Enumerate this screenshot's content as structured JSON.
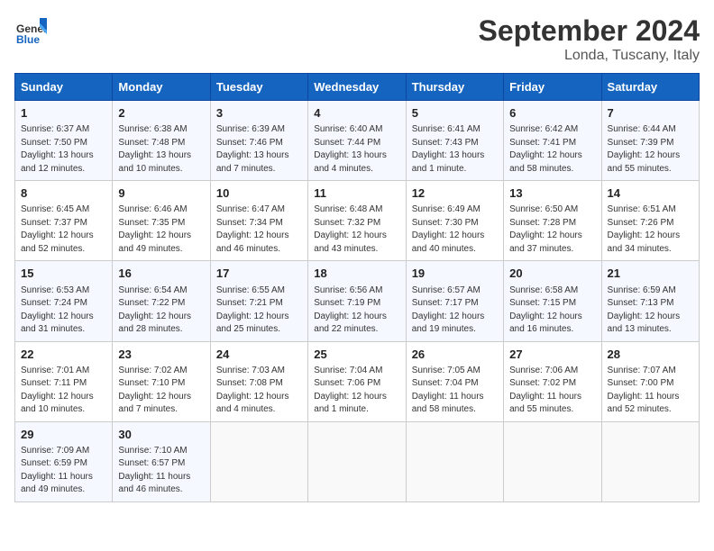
{
  "header": {
    "logo_line1": "General",
    "logo_line2": "Blue",
    "title": "September 2024",
    "location": "Londa, Tuscany, Italy"
  },
  "columns": [
    "Sunday",
    "Monday",
    "Tuesday",
    "Wednesday",
    "Thursday",
    "Friday",
    "Saturday"
  ],
  "weeks": [
    [
      {
        "day": "1",
        "lines": [
          "Sunrise: 6:37 AM",
          "Sunset: 7:50 PM",
          "Daylight: 13 hours",
          "and 12 minutes."
        ]
      },
      {
        "day": "2",
        "lines": [
          "Sunrise: 6:38 AM",
          "Sunset: 7:48 PM",
          "Daylight: 13 hours",
          "and 10 minutes."
        ]
      },
      {
        "day": "3",
        "lines": [
          "Sunrise: 6:39 AM",
          "Sunset: 7:46 PM",
          "Daylight: 13 hours",
          "and 7 minutes."
        ]
      },
      {
        "day": "4",
        "lines": [
          "Sunrise: 6:40 AM",
          "Sunset: 7:44 PM",
          "Daylight: 13 hours",
          "and 4 minutes."
        ]
      },
      {
        "day": "5",
        "lines": [
          "Sunrise: 6:41 AM",
          "Sunset: 7:43 PM",
          "Daylight: 13 hours",
          "and 1 minute."
        ]
      },
      {
        "day": "6",
        "lines": [
          "Sunrise: 6:42 AM",
          "Sunset: 7:41 PM",
          "Daylight: 12 hours",
          "and 58 minutes."
        ]
      },
      {
        "day": "7",
        "lines": [
          "Sunrise: 6:44 AM",
          "Sunset: 7:39 PM",
          "Daylight: 12 hours",
          "and 55 minutes."
        ]
      }
    ],
    [
      {
        "day": "8",
        "lines": [
          "Sunrise: 6:45 AM",
          "Sunset: 7:37 PM",
          "Daylight: 12 hours",
          "and 52 minutes."
        ]
      },
      {
        "day": "9",
        "lines": [
          "Sunrise: 6:46 AM",
          "Sunset: 7:35 PM",
          "Daylight: 12 hours",
          "and 49 minutes."
        ]
      },
      {
        "day": "10",
        "lines": [
          "Sunrise: 6:47 AM",
          "Sunset: 7:34 PM",
          "Daylight: 12 hours",
          "and 46 minutes."
        ]
      },
      {
        "day": "11",
        "lines": [
          "Sunrise: 6:48 AM",
          "Sunset: 7:32 PM",
          "Daylight: 12 hours",
          "and 43 minutes."
        ]
      },
      {
        "day": "12",
        "lines": [
          "Sunrise: 6:49 AM",
          "Sunset: 7:30 PM",
          "Daylight: 12 hours",
          "and 40 minutes."
        ]
      },
      {
        "day": "13",
        "lines": [
          "Sunrise: 6:50 AM",
          "Sunset: 7:28 PM",
          "Daylight: 12 hours",
          "and 37 minutes."
        ]
      },
      {
        "day": "14",
        "lines": [
          "Sunrise: 6:51 AM",
          "Sunset: 7:26 PM",
          "Daylight: 12 hours",
          "and 34 minutes."
        ]
      }
    ],
    [
      {
        "day": "15",
        "lines": [
          "Sunrise: 6:53 AM",
          "Sunset: 7:24 PM",
          "Daylight: 12 hours",
          "and 31 minutes."
        ]
      },
      {
        "day": "16",
        "lines": [
          "Sunrise: 6:54 AM",
          "Sunset: 7:22 PM",
          "Daylight: 12 hours",
          "and 28 minutes."
        ]
      },
      {
        "day": "17",
        "lines": [
          "Sunrise: 6:55 AM",
          "Sunset: 7:21 PM",
          "Daylight: 12 hours",
          "and 25 minutes."
        ]
      },
      {
        "day": "18",
        "lines": [
          "Sunrise: 6:56 AM",
          "Sunset: 7:19 PM",
          "Daylight: 12 hours",
          "and 22 minutes."
        ]
      },
      {
        "day": "19",
        "lines": [
          "Sunrise: 6:57 AM",
          "Sunset: 7:17 PM",
          "Daylight: 12 hours",
          "and 19 minutes."
        ]
      },
      {
        "day": "20",
        "lines": [
          "Sunrise: 6:58 AM",
          "Sunset: 7:15 PM",
          "Daylight: 12 hours",
          "and 16 minutes."
        ]
      },
      {
        "day": "21",
        "lines": [
          "Sunrise: 6:59 AM",
          "Sunset: 7:13 PM",
          "Daylight: 12 hours",
          "and 13 minutes."
        ]
      }
    ],
    [
      {
        "day": "22",
        "lines": [
          "Sunrise: 7:01 AM",
          "Sunset: 7:11 PM",
          "Daylight: 12 hours",
          "and 10 minutes."
        ]
      },
      {
        "day": "23",
        "lines": [
          "Sunrise: 7:02 AM",
          "Sunset: 7:10 PM",
          "Daylight: 12 hours",
          "and 7 minutes."
        ]
      },
      {
        "day": "24",
        "lines": [
          "Sunrise: 7:03 AM",
          "Sunset: 7:08 PM",
          "Daylight: 12 hours",
          "and 4 minutes."
        ]
      },
      {
        "day": "25",
        "lines": [
          "Sunrise: 7:04 AM",
          "Sunset: 7:06 PM",
          "Daylight: 12 hours",
          "and 1 minute."
        ]
      },
      {
        "day": "26",
        "lines": [
          "Sunrise: 7:05 AM",
          "Sunset: 7:04 PM",
          "Daylight: 11 hours",
          "and 58 minutes."
        ]
      },
      {
        "day": "27",
        "lines": [
          "Sunrise: 7:06 AM",
          "Sunset: 7:02 PM",
          "Daylight: 11 hours",
          "and 55 minutes."
        ]
      },
      {
        "day": "28",
        "lines": [
          "Sunrise: 7:07 AM",
          "Sunset: 7:00 PM",
          "Daylight: 11 hours",
          "and 52 minutes."
        ]
      }
    ],
    [
      {
        "day": "29",
        "lines": [
          "Sunrise: 7:09 AM",
          "Sunset: 6:59 PM",
          "Daylight: 11 hours",
          "and 49 minutes."
        ]
      },
      {
        "day": "30",
        "lines": [
          "Sunrise: 7:10 AM",
          "Sunset: 6:57 PM",
          "Daylight: 11 hours",
          "and 46 minutes."
        ]
      },
      {
        "day": "",
        "lines": []
      },
      {
        "day": "",
        "lines": []
      },
      {
        "day": "",
        "lines": []
      },
      {
        "day": "",
        "lines": []
      },
      {
        "day": "",
        "lines": []
      }
    ]
  ]
}
